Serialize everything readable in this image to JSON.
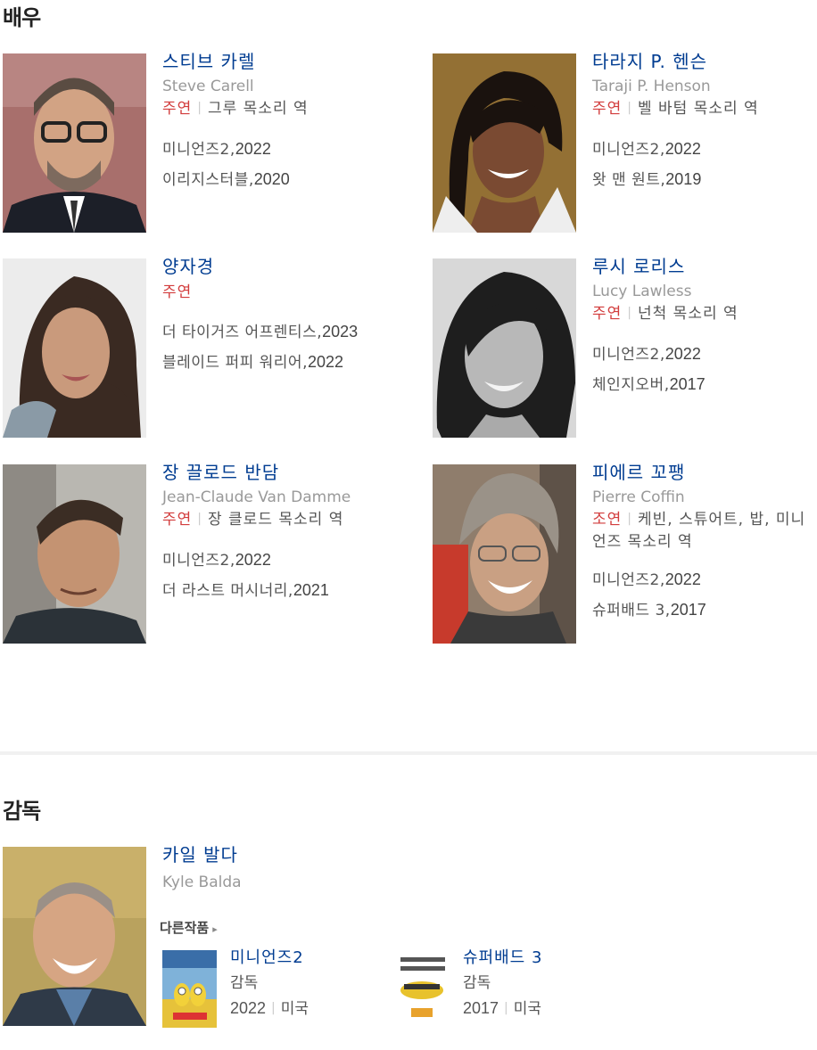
{
  "sections": {
    "actors_title": "배우",
    "director_title": "감독"
  },
  "actors": [
    {
      "name": "스티브 카렐",
      "name_en": "Steve Carell",
      "role_type": "주연",
      "role_desc": "그루 목소리 역",
      "works": [
        {
          "title": "미니언즈2,",
          "year": "2022"
        },
        {
          "title": "이리지스터블,",
          "year": "2020"
        }
      ]
    },
    {
      "name": "타라지 P. 헨슨",
      "name_en": "Taraji P. Henson",
      "role_type": "주연",
      "role_desc": "벨 바텀 목소리 역",
      "works": [
        {
          "title": "미니언즈2,",
          "year": "2022"
        },
        {
          "title": "왓 맨 원트,",
          "year": "2019"
        }
      ]
    },
    {
      "name": "양자경",
      "name_en": "",
      "role_type": "주연",
      "role_desc": "",
      "works": [
        {
          "title": "더 타이거즈 어프렌티스,",
          "year": "2023"
        },
        {
          "title": "블레이드 퍼피 워리어,",
          "year": "2022"
        }
      ]
    },
    {
      "name": "루시 로리스",
      "name_en": "Lucy Lawless",
      "role_type": "주연",
      "role_desc": "넌척 목소리 역",
      "works": [
        {
          "title": "미니언즈2,",
          "year": "2022"
        },
        {
          "title": "체인지오버,",
          "year": "2017"
        }
      ]
    },
    {
      "name": "장 끌로드 반담",
      "name_en": "Jean-Claude Van Damme",
      "role_type": "주연",
      "role_desc": "장 클로드 목소리 역",
      "works": [
        {
          "title": "미니언즈2,",
          "year": "2022"
        },
        {
          "title": "더 라스트 머시너리,",
          "year": "2021"
        }
      ]
    },
    {
      "name": "피에르 꼬팽",
      "name_en": "Pierre Coffin",
      "role_type": "조연",
      "role_desc": "케빈, 스튜어트, 밥, 미니언즈 목소리 역",
      "works": [
        {
          "title": "미니언즈2,",
          "year": "2022"
        },
        {
          "title": "슈퍼배드 3,",
          "year": "2017"
        }
      ]
    }
  ],
  "director": {
    "name": "카일 발다",
    "name_en": "Kyle Balda",
    "others_label": "다른작품",
    "films": [
      {
        "title": "미니언즈2",
        "role": "감독",
        "year": "2022",
        "country": "미국"
      },
      {
        "title": "슈퍼배드 3",
        "role": "감독",
        "year": "2017",
        "country": "미국"
      }
    ]
  }
}
